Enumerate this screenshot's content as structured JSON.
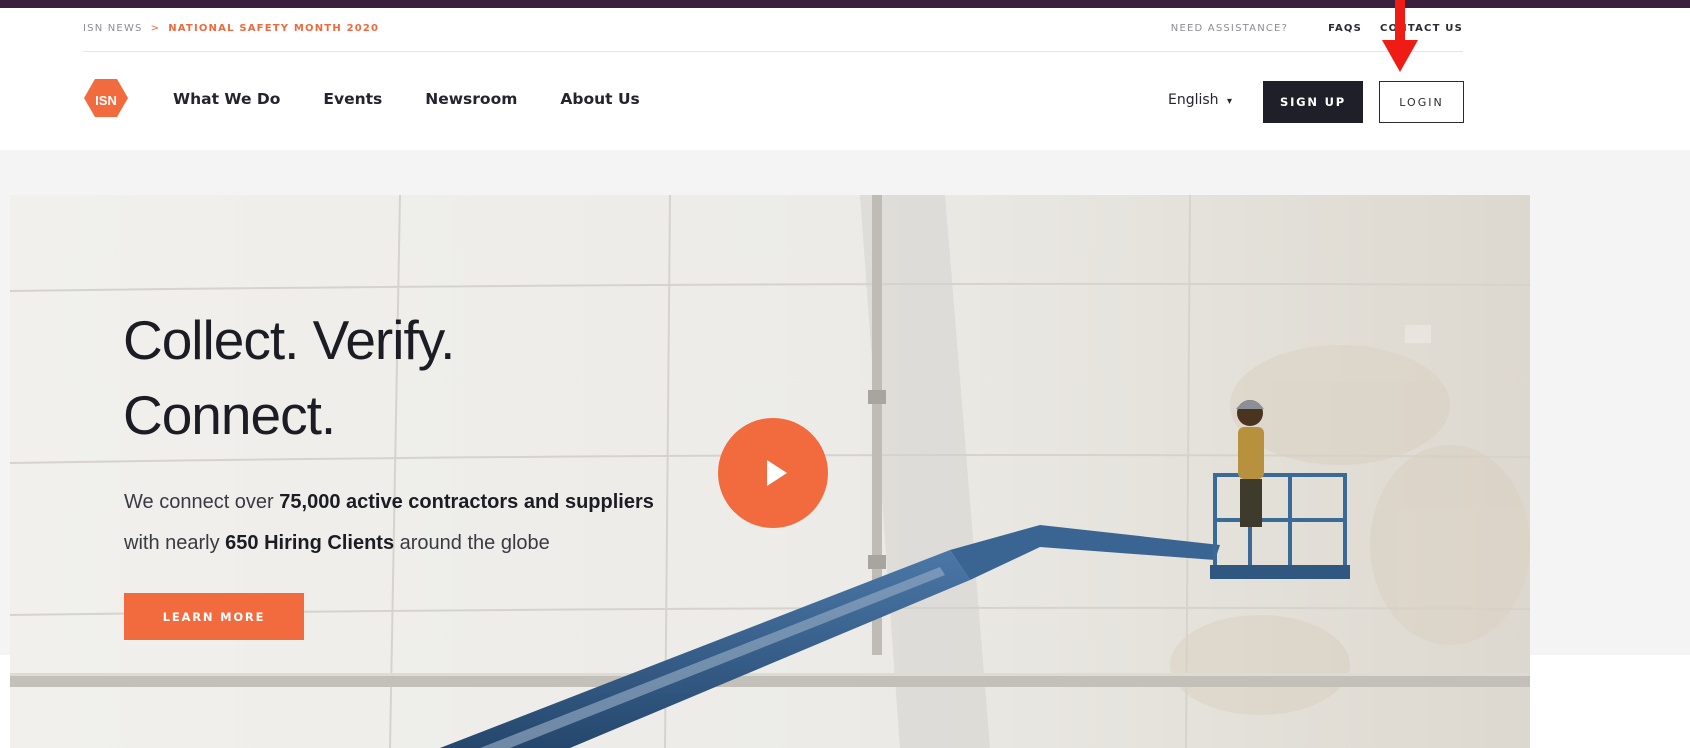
{
  "breadcrumb": {
    "root": "ISN NEWS",
    "separator": ">",
    "current": "NATIONAL SAFETY MONTH 2020"
  },
  "utility": {
    "assistance": "NEED ASSISTANCE?",
    "faqs": "FAQS",
    "contact": "CONTACT US"
  },
  "logo": {
    "text": "ISN",
    "color": "#f26b3f"
  },
  "nav": {
    "items": [
      {
        "label": "What We Do"
      },
      {
        "label": "Events"
      },
      {
        "label": "Newsroom"
      },
      {
        "label": "About Us"
      }
    ],
    "language": "English",
    "language_caret": "▾",
    "signup_label": "SIGN UP",
    "login_label": "LOGIN"
  },
  "hero": {
    "headline_line1": "Collect. Verify.",
    "headline_line2": "Connect.",
    "sub_line1_prefix": "We connect over ",
    "sub_line1_bold": "75,000 active contractors and suppliers",
    "sub_line2_prefix": "with nearly ",
    "sub_line2_bold": "650 Hiring Clients",
    "sub_line2_suffix": " around the globe",
    "cta_label": "LEARN MORE"
  },
  "icons": {
    "play": "play-icon",
    "caret": "chevron-down-icon",
    "annotation": "arrow-down-icon"
  },
  "colors": {
    "accent": "#f26b3f",
    "dark": "#1f1f2a",
    "top_rule": "#3b1f3f",
    "annotation": "#ee1c14"
  }
}
